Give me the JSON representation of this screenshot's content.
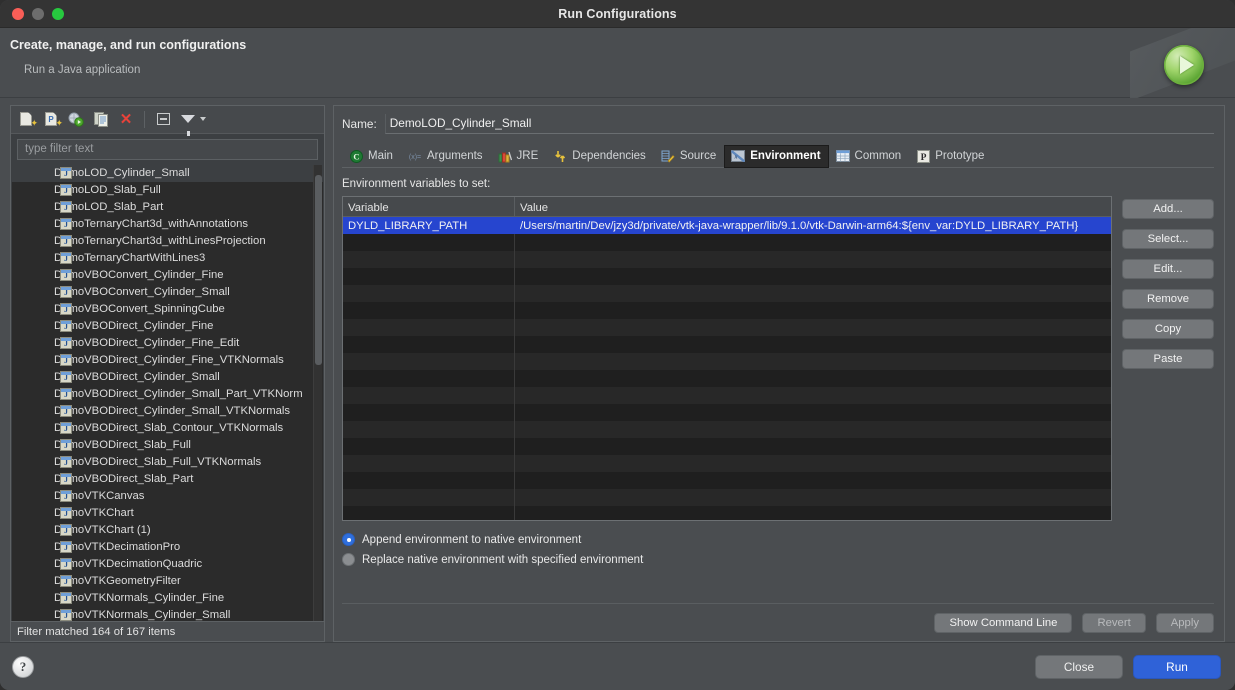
{
  "window": {
    "title": "Run Configurations",
    "traffic_lights": [
      "close-red",
      "minimize-gray",
      "zoom-green"
    ]
  },
  "header": {
    "title": "Create, manage, and run configurations",
    "subtitle": "Run a Java application",
    "art_icon": "green-run-play-button"
  },
  "left_pane": {
    "toolbar": [
      {
        "name": "new-configuration-icon",
        "label": "New launch configuration"
      },
      {
        "name": "new-prototype-icon",
        "label": "New prototype"
      },
      {
        "name": "export-configuration-icon",
        "label": "Export"
      },
      {
        "name": "duplicate-configuration-icon",
        "label": "Duplicate"
      },
      {
        "name": "delete-configuration-icon",
        "label": "Delete"
      },
      {
        "name": "collapse-all-icon",
        "label": "Collapse All"
      },
      {
        "name": "filter-icon",
        "label": "Filter"
      }
    ],
    "filter": {
      "placeholder": "type filter text",
      "value": ""
    },
    "selected_index": 0,
    "items": [
      "DemoLOD_Cylinder_Small",
      "DemoLOD_Slab_Full",
      "DemoLOD_Slab_Part",
      "DemoTernaryChart3d_withAnnotations",
      "DemoTernaryChart3d_withLinesProjection",
      "DemoTernaryChartWithLines3",
      "DemoVBOConvert_Cylinder_Fine",
      "DemoVBOConvert_Cylinder_Small",
      "DemoVBOConvert_SpinningCube",
      "DemoVBODirect_Cylinder_Fine",
      "DemoVBODirect_Cylinder_Fine_Edit",
      "DemoVBODirect_Cylinder_Fine_VTKNormals",
      "DemoVBODirect_Cylinder_Small",
      "DemoVBODirect_Cylinder_Small_Part_VTKNorm",
      "DemoVBODirect_Cylinder_Small_VTKNormals",
      "DemoVBODirect_Slab_Contour_VTKNormals",
      "DemoVBODirect_Slab_Full",
      "DemoVBODirect_Slab_Full_VTKNormals",
      "DemoVBODirect_Slab_Part",
      "DemoVTKCanvas",
      "DemoVTKChart",
      "DemoVTKChart (1)",
      "DemoVTKDecimationPro",
      "DemoVTKDecimationQuadric",
      "DemoVTKGeometryFilter",
      "DemoVTKNormals_Cylinder_Fine",
      "DemoVTKNormals_Cylinder_Small"
    ],
    "status": "Filter matched 164 of 167 items"
  },
  "right_pane": {
    "name_label": "Name:",
    "name_value": "DemoLOD_Cylinder_Small",
    "active_tab": "Environment",
    "tabs": [
      {
        "label": "Main",
        "icon": "java-class-icon"
      },
      {
        "label": "Arguments",
        "icon": "arguments-icon"
      },
      {
        "label": "JRE",
        "icon": "jre-books-icon"
      },
      {
        "label": "Dependencies",
        "icon": "dependencies-arrows-icon"
      },
      {
        "label": "Source",
        "icon": "source-pencil-icon"
      },
      {
        "label": "Environment",
        "icon": "environment-icon"
      },
      {
        "label": "Common",
        "icon": "common-table-icon"
      },
      {
        "label": "Prototype",
        "icon": "prototype-p-icon"
      }
    ],
    "section_label": "Environment variables to set:",
    "table": {
      "columns": [
        "Variable",
        "Value"
      ],
      "rows": [
        {
          "variable": "DYLD_LIBRARY_PATH",
          "value": "/Users/martin/Dev/jzy3d/private/vtk-java-wrapper/lib/9.1.0/vtk-Darwin-arm64:${env_var:DYLD_LIBRARY_PATH}",
          "selected": true
        }
      ],
      "empty_row_count": 17
    },
    "side_buttons": [
      "Add...",
      "Select...",
      "Edit...",
      "Remove",
      "Copy",
      "Paste"
    ],
    "radios": [
      {
        "label": "Append environment to native environment",
        "selected": true
      },
      {
        "label": "Replace native environment with specified environment",
        "selected": false
      }
    ],
    "action_buttons": [
      {
        "label": "Show Command Line",
        "enabled": true
      },
      {
        "label": "Revert",
        "enabled": false
      },
      {
        "label": "Apply",
        "enabled": false
      }
    ]
  },
  "footer": {
    "help_icon": "help-question-icon",
    "buttons": [
      {
        "label": "Close",
        "primary": false
      },
      {
        "label": "Run",
        "primary": true
      }
    ]
  },
  "colors": {
    "selection_blue": "#2645cf",
    "primary_button_blue": "#2f62d8",
    "window_bg": "#4a4d50",
    "list_bg": "#2b2b2b",
    "radio_blue": "#2f6fdd"
  }
}
